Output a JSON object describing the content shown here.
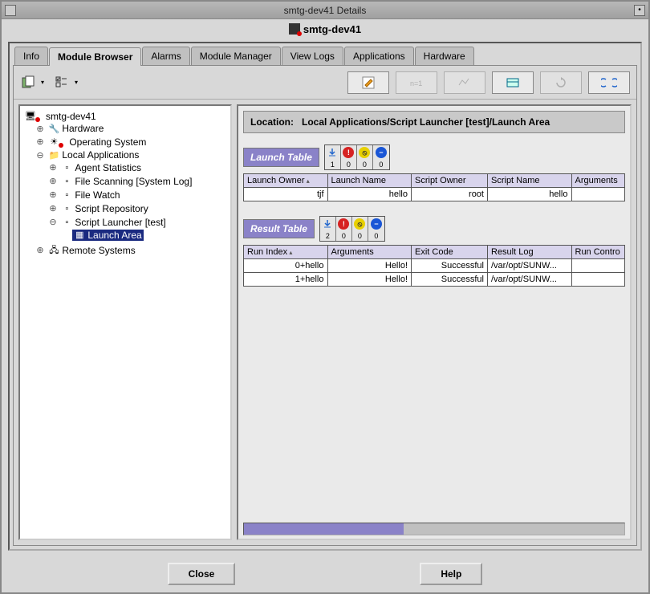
{
  "window": {
    "title": "smtg-dev41 Details",
    "subtitle": "smtg-dev41"
  },
  "tabs": [
    "Info",
    "Module Browser",
    "Alarms",
    "Module Manager",
    "View Logs",
    "Applications",
    "Hardware"
  ],
  "active_tab": "Module Browser",
  "tree": {
    "root": "smtg-dev41",
    "nodes": {
      "hardware": "Hardware",
      "os": "Operating System",
      "localapps": "Local Applications",
      "agent_stats": "Agent Statistics",
      "file_scan": "File Scanning [System Log]",
      "file_watch": "File Watch",
      "script_repo": "Script Repository",
      "script_launcher": "Script Launcher [test]",
      "launch_area": "Launch Area",
      "remote": "Remote Systems"
    },
    "selected": "launch_area"
  },
  "location": {
    "label": "Location:",
    "path": "Local Applications/Script Launcher [test]/Launch Area"
  },
  "launch_table": {
    "title": "Launch Table",
    "status_counts": [
      1,
      0,
      0,
      0
    ],
    "columns": [
      "Launch Owner",
      "Launch Name",
      "Script Owner",
      "Script Name",
      "Arguments"
    ],
    "rows": [
      {
        "owner": "tjf",
        "name": "hello",
        "scr_owner": "root",
        "scr_name": "hello",
        "args": ""
      }
    ]
  },
  "result_table": {
    "title": "Result Table",
    "status_counts": [
      2,
      0,
      0,
      0
    ],
    "columns": [
      "Run Index",
      "Arguments",
      "Exit Code",
      "Result Log",
      "Run Contro"
    ],
    "rows": [
      {
        "idx": "0+hello",
        "args": "Hello!",
        "exit": "Successful",
        "log": "/var/opt/SUNW...",
        "ctrl": ""
      },
      {
        "idx": "1+hello",
        "args": "Hello!",
        "exit": "Successful",
        "log": "/var/opt/SUNW...",
        "ctrl": ""
      }
    ]
  },
  "buttons": {
    "close": "Close",
    "help": "Help"
  }
}
